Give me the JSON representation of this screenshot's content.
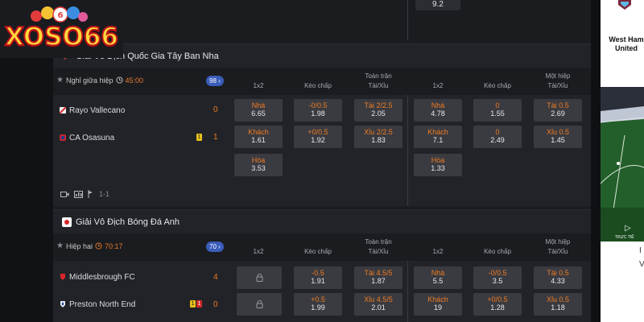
{
  "logo": {
    "text": "XOSO66"
  },
  "top": {
    "score": "9.2"
  },
  "leagues": [
    {
      "name": "Giải Vô Địch Quốc Gia Tây Ban Nha",
      "status": "Nghỉ giữa hiệp",
      "time": "45:00",
      "more_count": "98",
      "headers": {
        "c1x2": "1x2",
        "handicap": "Kèo chấp",
        "ou_line1": "Toàn trận",
        "ou_line2": "Tài/Xỉu",
        "h_1x2": "1x2",
        "h_handicap": "Kèo chấp",
        "h_ou_line1": "Một hiệp",
        "h_ou_line2": "Tài/Xỉu"
      },
      "teams": [
        {
          "name": "Rayo Vallecano",
          "score": "0",
          "cards": []
        },
        {
          "name": "CA Osasuna",
          "score": "1",
          "cards": [
            {
              "type": "yellow",
              "count": "1"
            }
          ]
        }
      ],
      "odds": {
        "full_1x2": [
          {
            "lbl": "Nhà",
            "val": "6.65"
          },
          {
            "lbl": "Khách",
            "val": "1.61"
          },
          {
            "lbl": "Hòa",
            "val": "3.53"
          }
        ],
        "full_hdp": [
          {
            "lbl": "-0/0.5",
            "val": "1.98"
          },
          {
            "lbl": "+0/0.5",
            "val": "1.92"
          }
        ],
        "full_ou": [
          {
            "lbl": "Tài 2/2.5",
            "val": "2.05"
          },
          {
            "lbl": "Xỉu 2/2.5",
            "val": "1.83"
          }
        ],
        "half_1x2": [
          {
            "lbl": "Nhà",
            "val": "4.78"
          },
          {
            "lbl": "Khách",
            "val": "7.1"
          },
          {
            "lbl": "Hòa",
            "val": "1.33"
          }
        ],
        "half_hdp": [
          {
            "lbl": "0",
            "val": "1.55"
          },
          {
            "lbl": "0",
            "val": "2.49"
          }
        ],
        "half_ou": [
          {
            "lbl": "Tài 0.5",
            "val": "2.69"
          },
          {
            "lbl": "Xỉu 0.5",
            "val": "1.45"
          }
        ]
      },
      "footer": "1-1"
    },
    {
      "name": "Giải Vô Địch Bóng Đá Anh",
      "status": "Hiệp hai",
      "time": "70:17",
      "more_count": "70",
      "headers": {
        "c1x2": "1x2",
        "handicap": "Kèo chấp",
        "ou_line1": "Toàn trận",
        "ou_line2": "Tài/Xỉu",
        "h_1x2": "1x2",
        "h_handicap": "Kèo chấp",
        "h_ou_line1": "Một hiệp",
        "h_ou_line2": "Tài/Xỉu"
      },
      "teams": [
        {
          "name": "Middlesbrough FC",
          "score": "4",
          "cards": []
        },
        {
          "name": "Preston North End",
          "score": "0",
          "cards": [
            {
              "type": "yellow",
              "count": "1"
            },
            {
              "type": "red",
              "count": "1"
            }
          ]
        }
      ],
      "odds": {
        "full_hdp": [
          {
            "lbl": "-0.5",
            "val": "1.91"
          },
          {
            "lbl": "+0.5",
            "val": "1.99"
          }
        ],
        "full_ou": [
          {
            "lbl": "Tài 4.5/5",
            "val": "1.87"
          },
          {
            "lbl": "Xỉu 4.5/5",
            "val": "2.01"
          }
        ],
        "half_1x2": [
          {
            "lbl": "Nhà",
            "val": "5.5"
          },
          {
            "lbl": "Khách",
            "val": "19"
          }
        ],
        "half_hdp": [
          {
            "lbl": "-0/0.5",
            "val": "3.5"
          },
          {
            "lbl": "+0/0.5",
            "val": "1.28"
          }
        ],
        "half_ou": [
          {
            "lbl": "Tài 0.5",
            "val": "4.33"
          },
          {
            "lbl": "Xỉu 0.5",
            "val": "1.18"
          }
        ]
      }
    }
  ],
  "right_panel": {
    "team": "West Ham United",
    "live_label": "TRỰC TIẾ",
    "letter1": "I",
    "letter2": "V"
  },
  "colors": {
    "accent": "#f07b20",
    "badge": "#3a5dbb",
    "cell": "#3a3b41"
  }
}
